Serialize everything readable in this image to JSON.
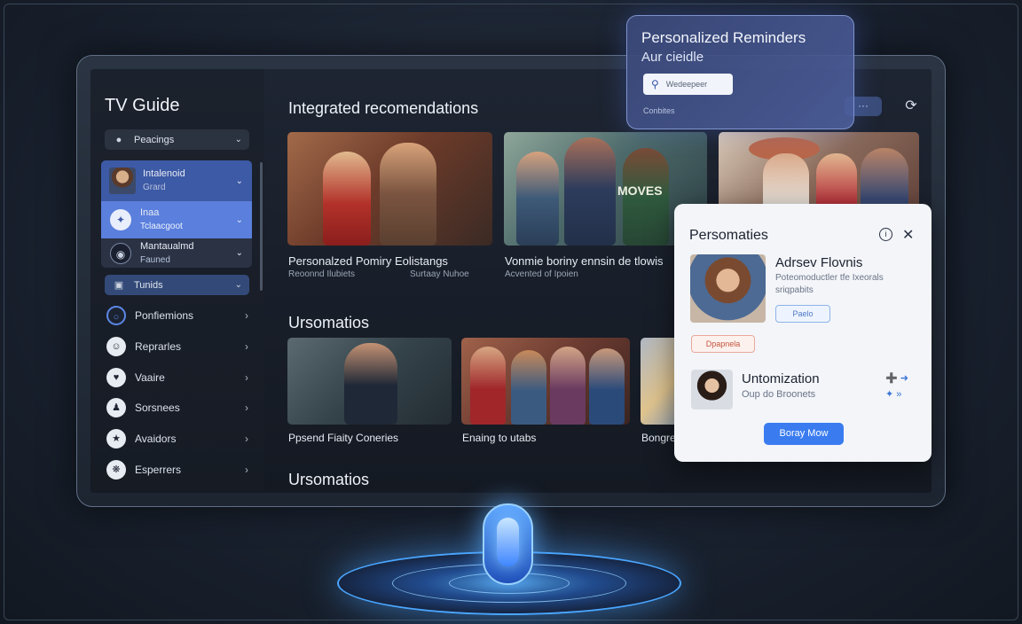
{
  "sidebar": {
    "title": "TV Guide",
    "dropdown_top": "Peacings",
    "expanded": [
      {
        "label": "Intalenoid",
        "sub": "Grard"
      },
      {
        "label": "Inaa",
        "sub": "Tclaacgoot"
      },
      {
        "label": "Mantaualmd",
        "sub": "Fauned"
      }
    ],
    "dropdown_tunids": "Tunids",
    "items": [
      {
        "label": "Ponfiemions"
      },
      {
        "label": "Reprarles"
      },
      {
        "label": "Vaaire"
      },
      {
        "label": "Sorsnees"
      },
      {
        "label": "Avaidors"
      },
      {
        "label": "Esperrers"
      }
    ]
  },
  "main": {
    "section1": "Integrated recomendations",
    "section2": "Ursomatios",
    "section3": "Ursomatios",
    "cards_row1": [
      {
        "title": "Personalzed Pomiry Eolistangs",
        "sub1": "Reoonnd Ilubiets",
        "sub2": "Surtaay Nuhoe"
      },
      {
        "title": "Vonmie boriny ennsin de tlowis",
        "sub1": "Acvented of Ipoien",
        "overlay": "MOVES"
      },
      {
        "title": "",
        "sub1": ""
      }
    ],
    "cards_row2": [
      {
        "title": "Ppsend Fiaity Coneries"
      },
      {
        "title": "Enaing to utabs"
      },
      {
        "title": "Bongre"
      }
    ],
    "more": "···",
    "refresh_icon": "refresh-icon"
  },
  "reminders": {
    "title": "Personalized Reminders",
    "subtitle": "Aur cieidle",
    "search_value": "Wedeepeer",
    "footer": "Conbites"
  },
  "person_card": {
    "title": "Persomaties",
    "name": "Adrsev Flovnis",
    "desc": "Poteomoductler tfe Ixeorals sriqpabits",
    "tag1": "Paelo",
    "tag2": "Dpapnela",
    "name2": "Untomization",
    "sub2": "Oup do Broonets",
    "button": "Boray Mow"
  },
  "colors": {
    "accent": "#3a7cf0",
    "highlight": "#5a7fdc",
    "glow": "#4aa6ff"
  }
}
